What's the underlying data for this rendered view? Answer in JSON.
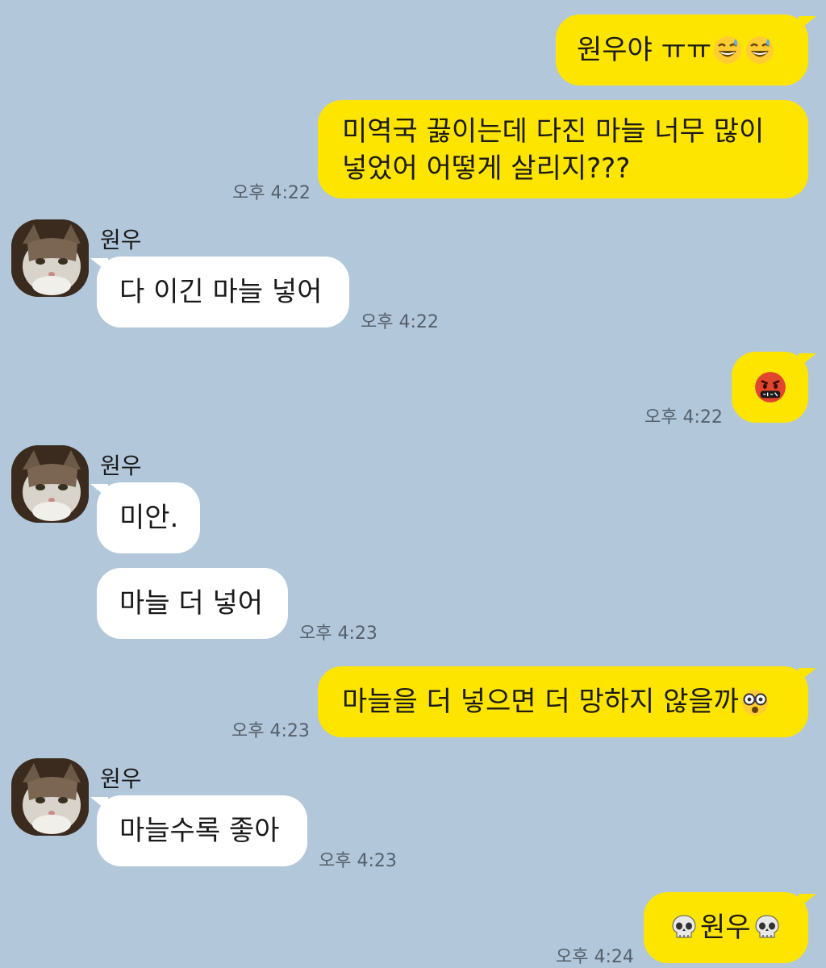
{
  "contact": {
    "name": "원우"
  },
  "messages": [
    {
      "id": "m1",
      "sender": "me",
      "text": "원우야 ㅠㅠ",
      "emoji_after": [
        "grinning-sweat-icon",
        "grinning-sweat-icon"
      ]
    },
    {
      "id": "m2",
      "sender": "me",
      "text": "미역국 끓이는데 다진 마늘 너무 많이 넣었어 어떻게 살리지???",
      "time": "오후 4:22"
    },
    {
      "id": "m3",
      "sender": "other",
      "name": "원우",
      "text": "다 이긴 마늘 넣어",
      "time": "오후 4:22"
    },
    {
      "id": "m4",
      "sender": "me",
      "emoji": "cursing-face-icon",
      "time": "오후 4:22"
    },
    {
      "id": "m5",
      "sender": "other",
      "name": "원우",
      "text": "미안."
    },
    {
      "id": "m6",
      "sender": "other",
      "text": "마늘 더 넣어",
      "time": "오후 4:23"
    },
    {
      "id": "m7",
      "sender": "me",
      "text": "마늘을 더 넣으면 더 망하지 않을까",
      "emoji_after": [
        "disguised-glasses-icon"
      ],
      "time": "오후 4:23"
    },
    {
      "id": "m8",
      "sender": "other",
      "name": "원우",
      "text": "마늘수록 좋아",
      "time": "오후 4:23"
    },
    {
      "id": "m9",
      "sender": "me",
      "text": "원우",
      "emoji_before": "skull-icon",
      "emoji_after": [
        "skull-icon"
      ],
      "time": "오후 4:24"
    }
  ],
  "colors": {
    "background": "#b2c7da",
    "my_bubble": "#fee500",
    "other_bubble": "#ffffff",
    "timestamp": "#55606b"
  }
}
